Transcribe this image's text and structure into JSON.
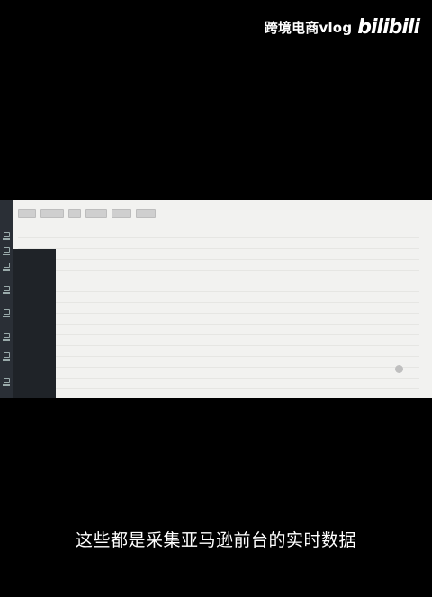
{
  "watermark": {
    "channel": "跨境电商vlog",
    "logo": "bilibili"
  },
  "subtitle": "这些都是采集亚马逊前台的实时数据",
  "screen": {
    "submenu_items": [
      "",
      "",
      "",
      "",
      "",
      "",
      "",
      "",
      "",
      ""
    ],
    "table": {
      "columns": [
        "",
        "",
        "",
        "",
        "",
        "",
        "",
        "",
        "",
        "",
        "",
        "",
        ""
      ],
      "row_count": 17
    }
  }
}
